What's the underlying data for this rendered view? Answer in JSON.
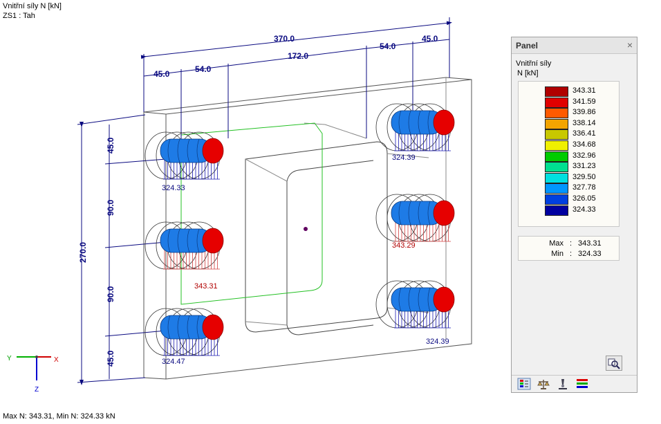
{
  "header": {
    "line1": "Vnitřní síly N [kN]",
    "line2": "ZS1 : Tah"
  },
  "status": "Max N: 343.31, Min N: 324.33 kN",
  "axes": {
    "y": "Y",
    "x": "X",
    "z": "Z"
  },
  "dimensions": {
    "total_width": "370.0",
    "top_right_1": "54.0",
    "top_right_2": "45.0",
    "middle": "172.0",
    "left_1": "45.0",
    "left_2": "54.0",
    "total_height": "270.0",
    "v_top": "45.0",
    "v_mid1": "90.0",
    "v_mid2": "90.0",
    "v_bottom": "45.0"
  },
  "bolt_labels": {
    "top_left": "324.33",
    "top_right": "324.39",
    "middle_left": "343.31",
    "middle_right": "343.29",
    "bottom_left": "324.47",
    "bottom_right": "324.39"
  },
  "panel": {
    "title": "Panel",
    "close": "×",
    "quantity": "Vnitřní síly",
    "unit": "N [kN]",
    "legend": [
      {
        "value": "343.31",
        "color": "#b00000"
      },
      {
        "value": "341.59",
        "color": "#e00000"
      },
      {
        "value": "339.86",
        "color": "#ff5a00"
      },
      {
        "value": "338.14",
        "color": "#f3a400"
      },
      {
        "value": "336.41",
        "color": "#c8c800"
      },
      {
        "value": "334.68",
        "color": "#f0f000"
      },
      {
        "value": "332.96",
        "color": "#00cc00"
      },
      {
        "value": "331.23",
        "color": "#00e090"
      },
      {
        "value": "329.50",
        "color": "#00e0e0"
      },
      {
        "value": "327.78",
        "color": "#0096ff"
      },
      {
        "value": "326.05",
        "color": "#0040e0"
      },
      {
        "value": "324.33",
        "color": "#0000a0"
      }
    ],
    "max_label": "Max",
    "min_label": "Min",
    "sep": ":",
    "max_value": "343.31",
    "min_value": "324.33"
  }
}
